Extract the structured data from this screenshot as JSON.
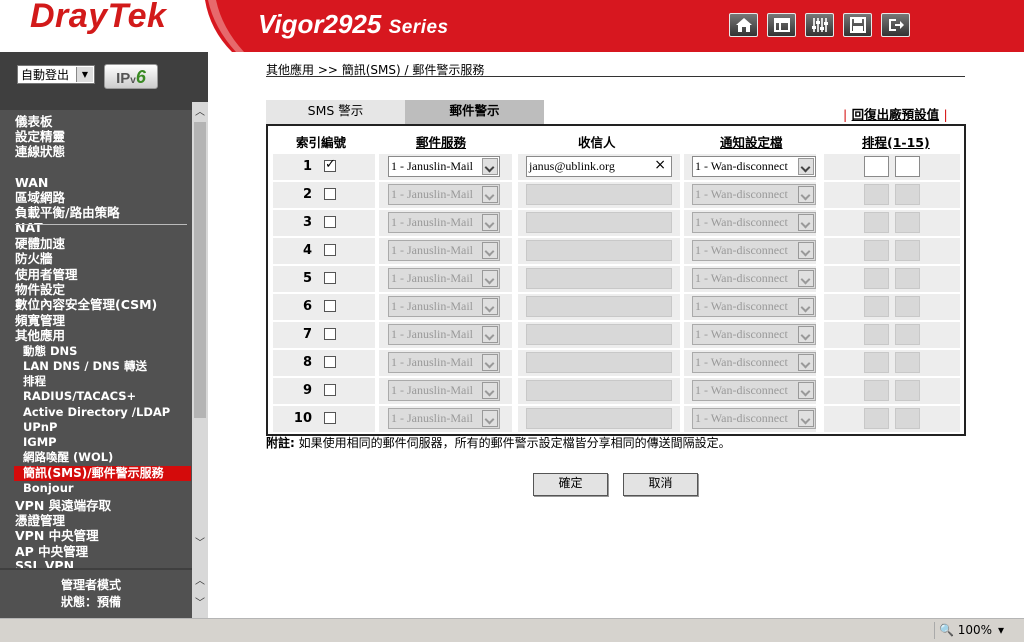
{
  "header": {
    "brand": "DrayTek",
    "model": "Vigor2925",
    "series": "Series",
    "icons": [
      "home-icon",
      "quick-start-icon",
      "settings-sliders-icon",
      "save-icon",
      "logout-icon"
    ]
  },
  "sidebar": {
    "logout_select": "自動登出",
    "ipv6_label_ip": "IP",
    "ipv6_label_v": "v",
    "ipv6_label_6": "6",
    "items": [
      {
        "label": "儀表板",
        "kind": "grp"
      },
      {
        "label": "設定精靈",
        "kind": "grp"
      },
      {
        "label": "連線狀態",
        "kind": "grp"
      },
      {
        "label": "WAN",
        "kind": "grp"
      },
      {
        "label": "區域網路",
        "kind": "grp"
      },
      {
        "label": "負載平衡/路由策略",
        "kind": "grp"
      },
      {
        "label": "NAT",
        "kind": "grp"
      },
      {
        "label": "硬體加速",
        "kind": "grp"
      },
      {
        "label": "防火牆",
        "kind": "grp"
      },
      {
        "label": "使用者管理",
        "kind": "grp"
      },
      {
        "label": "物件設定",
        "kind": "grp"
      },
      {
        "label": "數位內容安全管理(CSM)",
        "kind": "grp"
      },
      {
        "label": "頻寬管理",
        "kind": "grp"
      },
      {
        "label": "其他應用",
        "kind": "grp"
      },
      {
        "label": "動態 DNS",
        "kind": "sub"
      },
      {
        "label": "LAN DNS / DNS 轉送",
        "kind": "sub"
      },
      {
        "label": "排程",
        "kind": "sub"
      },
      {
        "label": "RADIUS/TACACS+",
        "kind": "sub"
      },
      {
        "label": "Active Directory /LDAP",
        "kind": "sub"
      },
      {
        "label": "UPnP",
        "kind": "sub"
      },
      {
        "label": "IGMP",
        "kind": "sub"
      },
      {
        "label": "網路喚醒 (WOL)",
        "kind": "sub"
      },
      {
        "label": "簡訊(SMS)/郵件警示服務",
        "kind": "hl"
      },
      {
        "label": "Bonjour",
        "kind": "sub"
      },
      {
        "label": "VPN 與遠端存取",
        "kind": "grp"
      },
      {
        "label": "憑證管理",
        "kind": "grp"
      },
      {
        "label": "VPN 中央管理",
        "kind": "grp"
      },
      {
        "label": "AP 中央管理",
        "kind": "grp"
      },
      {
        "label": "SSL VPN",
        "kind": "grp"
      }
    ],
    "admin_mode": "管理者模式",
    "status": "狀態：預備"
  },
  "main": {
    "breadcrumb": "其他應用 >> 簡訊(SMS) / 郵件警示服務",
    "tabs": [
      {
        "label": "SMS 警示",
        "active": false
      },
      {
        "label": "郵件警示",
        "active": true
      }
    ],
    "restore_default": "回復出廠預設值",
    "columns": {
      "index": "索引編號",
      "mail_service": "郵件服務",
      "recipient": "收信人",
      "notify_profile": "通知設定檔",
      "schedule": "排程(1-15)"
    },
    "rows": [
      {
        "index": "1",
        "checked": true,
        "mail_service": "1 - Januslin-Mail",
        "recipient": "janus@ublink.org",
        "notify_profile": "1 - Wan-disconnect",
        "enabled": true
      },
      {
        "index": "2",
        "checked": false,
        "mail_service": "1 - Januslin-Mail",
        "recipient": "",
        "notify_profile": "1 - Wan-disconnect",
        "enabled": false
      },
      {
        "index": "3",
        "checked": false,
        "mail_service": "1 - Januslin-Mail",
        "recipient": "",
        "notify_profile": "1 - Wan-disconnect",
        "enabled": false
      },
      {
        "index": "4",
        "checked": false,
        "mail_service": "1 - Januslin-Mail",
        "recipient": "",
        "notify_profile": "1 - Wan-disconnect",
        "enabled": false
      },
      {
        "index": "5",
        "checked": false,
        "mail_service": "1 - Januslin-Mail",
        "recipient": "",
        "notify_profile": "1 - Wan-disconnect",
        "enabled": false
      },
      {
        "index": "6",
        "checked": false,
        "mail_service": "1 - Januslin-Mail",
        "recipient": "",
        "notify_profile": "1 - Wan-disconnect",
        "enabled": false
      },
      {
        "index": "7",
        "checked": false,
        "mail_service": "1 - Januslin-Mail",
        "recipient": "",
        "notify_profile": "1 - Wan-disconnect",
        "enabled": false
      },
      {
        "index": "8",
        "checked": false,
        "mail_service": "1 - Januslin-Mail",
        "recipient": "",
        "notify_profile": "1 - Wan-disconnect",
        "enabled": false
      },
      {
        "index": "9",
        "checked": false,
        "mail_service": "1 - Januslin-Mail",
        "recipient": "",
        "notify_profile": "1 - Wan-disconnect",
        "enabled": false
      },
      {
        "index": "10",
        "checked": false,
        "mail_service": "1 - Januslin-Mail",
        "recipient": "",
        "notify_profile": "1 - Wan-disconnect",
        "enabled": false
      }
    ],
    "note_label": "附註:",
    "note_text": " 如果使用相同的郵件伺服器，所有的郵件警示設定檔皆分享相同的傳送間隔設定。",
    "ok_button": "確定",
    "cancel_button": "取消"
  },
  "statusbar": {
    "zoom": "100%"
  },
  "colors": {
    "brand_red": "#d21a1a",
    "highlight": "#d40b0b",
    "sidebar": "#515151"
  }
}
